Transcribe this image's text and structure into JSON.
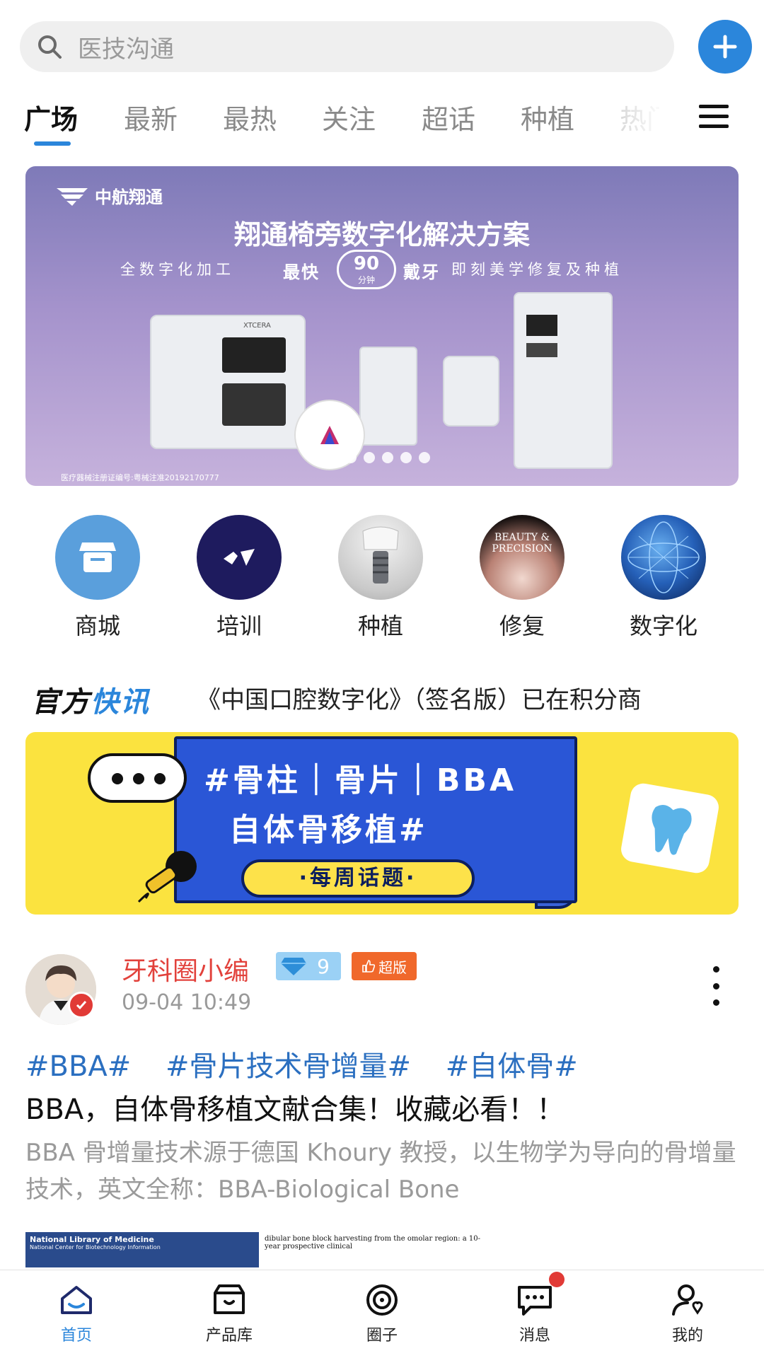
{
  "search": {
    "placeholder": "医技沟通"
  },
  "tabs": [
    {
      "label": "广场",
      "active": true
    },
    {
      "label": "最新"
    },
    {
      "label": "最热"
    },
    {
      "label": "关注"
    },
    {
      "label": "超话"
    },
    {
      "label": "种植"
    },
    {
      "label": "热门"
    }
  ],
  "banner": {
    "brand": "中航翔通",
    "title": "翔通椅旁数字化解决方案",
    "sub_left": "全数字化加工",
    "sub_mid_a": "最快",
    "sub_mid_num": "90",
    "sub_mid_unit": "分钟",
    "sub_mid_b": "戴牙",
    "sub_right": "即刻美学修复及种植",
    "cert": "医疗器械注册证编号:粤械注准20192170777",
    "machine_label": "XTCERA"
  },
  "categories": [
    {
      "label": "商城",
      "icon": "store-icon",
      "color": "#5a9fdc"
    },
    {
      "label": "培训",
      "icon": "training-flags-icon",
      "color": "#1e1b5e"
    },
    {
      "label": "种植",
      "icon": "implant-icon"
    },
    {
      "label": "修复",
      "icon": "restoration-icon",
      "overlay": "BEAUTY & PRECISION"
    },
    {
      "label": "数字化",
      "icon": "digital-globe-icon"
    }
  ],
  "news": {
    "logo_a": "官方",
    "logo_b": "快讯",
    "text": "《中国口腔数字化》（签名版）已在积分商"
  },
  "topic": {
    "line1": "#骨柱｜骨片｜BBA",
    "line2": "自体骨移植#",
    "pill": "·每周话题·"
  },
  "post": {
    "username": "牙科圈小编",
    "level": "9",
    "role": "超版",
    "time": "09-04 10:49",
    "hashtags": [
      "#BBA#",
      "#骨片技术骨增量#",
      "#自体骨#"
    ],
    "title": "BBA，自体骨移植文献合集！收藏必看！！",
    "excerpt": "BBA 骨增量技术源于德国 Khoury 教授，以生物学为导向的骨增量技术，英文全称：BBA-Biological Bone",
    "thumb_left_title": "National Library of Medicine",
    "thumb_left_sub": "National Center for Biotechnology Information",
    "thumb_right_text": "dibular bone block harvesting from the omolar region: a 10-year prospective clinical"
  },
  "bottom_nav": [
    {
      "label": "首页",
      "icon": "home-icon",
      "active": true
    },
    {
      "label": "产品库",
      "icon": "product-store-icon"
    },
    {
      "label": "圈子",
      "icon": "circle-target-icon"
    },
    {
      "label": "消息",
      "icon": "message-icon",
      "has_badge": true
    },
    {
      "label": "我的",
      "icon": "profile-icon"
    }
  ],
  "colors": {
    "accent": "#2b86db",
    "username": "#e2413b",
    "topic_bg": "#fbe33f",
    "topic_card": "#2a56d6"
  }
}
